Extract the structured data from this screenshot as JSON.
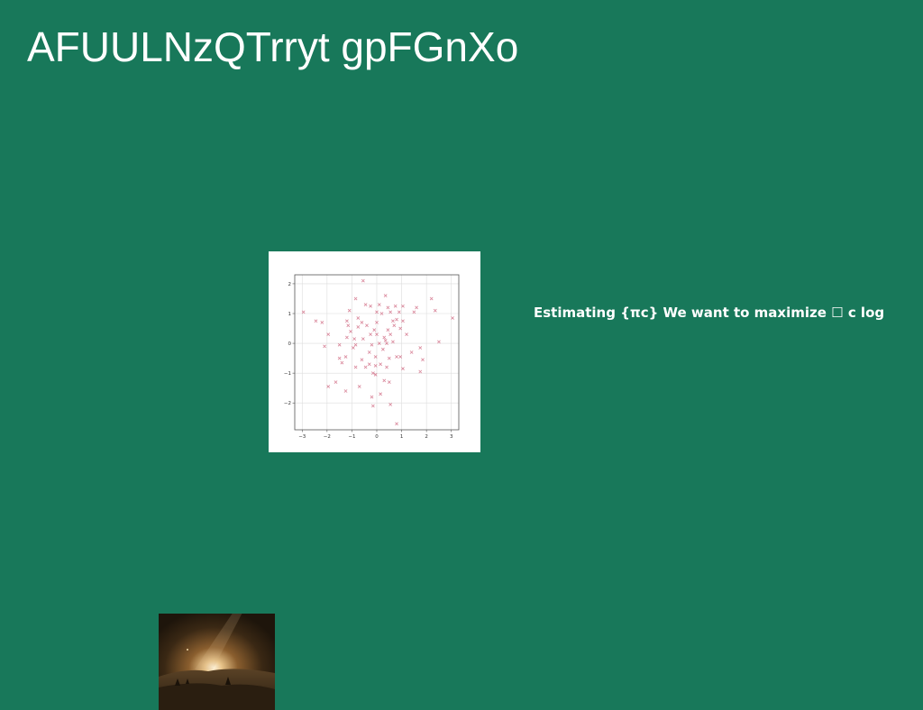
{
  "slide": {
    "title": "AFUULNzQTrryt gpFGnXo",
    "body_text": "Estimating {πc} We want to maximize ☐ c log",
    "background_color": "#18785a",
    "text_color": "#ffffff"
  },
  "photo": {
    "description_icon": "sunset-landscape-photo"
  },
  "chart_data": {
    "type": "scatter",
    "marker": "x",
    "marker_color": "#d9869a",
    "grid": true,
    "xlim": [
      -3.3,
      3.3
    ],
    "ylim": [
      -2.9,
      2.3
    ],
    "x_ticks": [
      -3,
      -2,
      -1,
      0,
      1,
      2,
      3
    ],
    "y_ticks": [
      -2,
      -1,
      0,
      1,
      2
    ],
    "x_tick_labels": [
      "−3",
      "−2",
      "−1",
      "0",
      "1",
      "2",
      "3"
    ],
    "y_tick_labels": [
      "−2",
      "−1",
      "0",
      "1",
      "2"
    ],
    "points": [
      [
        -0.55,
        2.1
      ],
      [
        0.35,
        1.6
      ],
      [
        -0.85,
        1.5
      ],
      [
        2.2,
        1.5
      ],
      [
        -0.45,
        1.3
      ],
      [
        -0.25,
        1.25
      ],
      [
        0.1,
        1.3
      ],
      [
        0.45,
        1.2
      ],
      [
        0.75,
        1.25
      ],
      [
        1.05,
        1.25
      ],
      [
        1.6,
        1.2
      ],
      [
        -2.95,
        1.05
      ],
      [
        -1.1,
        1.1
      ],
      [
        0.0,
        1.05
      ],
      [
        0.55,
        1.05
      ],
      [
        0.9,
        1.05
      ],
      [
        1.5,
        1.05
      ],
      [
        2.35,
        1.1
      ],
      [
        0.2,
        1.0
      ],
      [
        -0.75,
        0.85
      ],
      [
        0.65,
        0.75
      ],
      [
        1.05,
        0.75
      ],
      [
        -2.45,
        0.75
      ],
      [
        -2.2,
        0.7
      ],
      [
        -1.2,
        0.75
      ],
      [
        -0.6,
        0.7
      ],
      [
        0.0,
        0.7
      ],
      [
        0.8,
        0.8
      ],
      [
        3.05,
        0.85
      ],
      [
        -1.15,
        0.6
      ],
      [
        -0.75,
        0.55
      ],
      [
        0.45,
        0.45
      ],
      [
        -1.05,
        0.4
      ],
      [
        -1.95,
        0.3
      ],
      [
        -0.25,
        0.3
      ],
      [
        0.0,
        0.3
      ],
      [
        0.55,
        0.3
      ],
      [
        1.2,
        0.3
      ],
      [
        -0.9,
        0.15
      ],
      [
        -0.55,
        0.15
      ],
      [
        0.35,
        0.1
      ],
      [
        0.65,
        0.05
      ],
      [
        -1.5,
        -0.05
      ],
      [
        -0.85,
        -0.05
      ],
      [
        -0.2,
        -0.05
      ],
      [
        0.1,
        0.0
      ],
      [
        0.4,
        0.0
      ],
      [
        2.5,
        0.05
      ],
      [
        -2.1,
        -0.1
      ],
      [
        -0.95,
        -0.15
      ],
      [
        -0.3,
        -0.3
      ],
      [
        1.75,
        -0.15
      ],
      [
        -1.25,
        -0.45
      ],
      [
        -1.5,
        -0.5
      ],
      [
        0.5,
        -0.5
      ],
      [
        0.95,
        -0.45
      ],
      [
        0.8,
        -0.45
      ],
      [
        1.85,
        -0.55
      ],
      [
        -1.4,
        -0.65
      ],
      [
        -0.3,
        -0.7
      ],
      [
        -0.05,
        -0.75
      ],
      [
        0.15,
        -0.7
      ],
      [
        -0.45,
        -0.8
      ],
      [
        -0.85,
        -0.8
      ],
      [
        0.4,
        -0.8
      ],
      [
        1.05,
        -0.85
      ],
      [
        1.75,
        -0.95
      ],
      [
        -0.15,
        -1.0
      ],
      [
        -0.05,
        -1.05
      ],
      [
        0.3,
        -1.25
      ],
      [
        0.5,
        -1.3
      ],
      [
        -1.65,
        -1.3
      ],
      [
        -1.95,
        -1.45
      ],
      [
        -0.7,
        -1.45
      ],
      [
        -1.25,
        -1.6
      ],
      [
        0.15,
        -1.7
      ],
      [
        -0.2,
        -1.8
      ],
      [
        0.55,
        -2.05
      ],
      [
        -0.15,
        -2.1
      ],
      [
        0.8,
        -2.7
      ],
      [
        0.7,
        0.6
      ],
      [
        0.95,
        0.5
      ],
      [
        -0.1,
        0.45
      ],
      [
        0.3,
        0.2
      ],
      [
        -0.6,
        -0.55
      ],
      [
        -0.05,
        -0.45
      ],
      [
        0.25,
        -0.2
      ],
      [
        -0.4,
        0.6
      ],
      [
        -1.2,
        0.2
      ],
      [
        1.4,
        -0.3
      ]
    ]
  }
}
